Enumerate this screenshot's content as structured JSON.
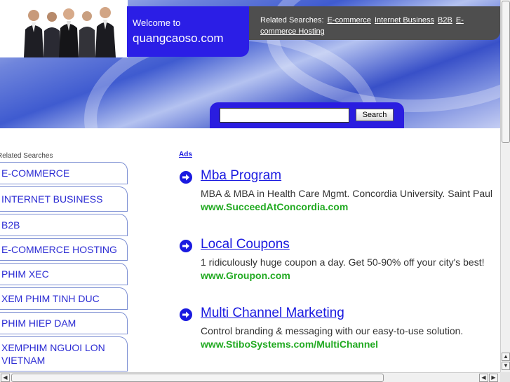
{
  "header": {
    "welcome_line1": "Welcome to",
    "welcome_line2": "quangcaoso.com",
    "related_label": "Related Searches:",
    "related_links": [
      "E-commerce",
      "Internet Business",
      "B2B",
      "E-commerce Hosting"
    ]
  },
  "search": {
    "input_value": "",
    "button_label": "Search"
  },
  "sidebar": {
    "title": "Related Searches",
    "items": [
      "E-COMMERCE",
      "INTERNET BUSINESS",
      "B2B",
      "E-COMMERCE HOSTING",
      "PHIM XEC",
      "XEM PHIM TINH DUC",
      "PHIM HIEP DAM",
      "XEMPHIM NGUOI LON VIETNAM"
    ]
  },
  "ads": {
    "label": "Ads",
    "items": [
      {
        "title": "Mba Program",
        "description": "MBA & MBA in Health Care Mgmt. Concordia University. Saint Paul",
        "url": "www.SucceedAtConcordia.com"
      },
      {
        "title": "Local Coupons",
        "description": "1 ridiculously huge coupon a day. Get 50-90% off your city's best!",
        "url": "www.Groupon.com"
      },
      {
        "title": "Multi Channel Marketing",
        "description": "Control branding & messaging with our easy-to-use solution.",
        "url": "www.StiboSystems.com/MultiChannel"
      }
    ]
  },
  "colors": {
    "brand_blue": "#2b1ee6",
    "link_blue": "#1a1ae0",
    "url_green": "#22aa22",
    "dark_gray": "#4e4e4e"
  },
  "icons": {
    "ad_bullet": "arrow-circle-icon",
    "scroll_up": "arrow-up-icon",
    "scroll_down": "arrow-down-icon",
    "scroll_left": "arrow-left-icon",
    "scroll_right": "arrow-right-icon"
  }
}
